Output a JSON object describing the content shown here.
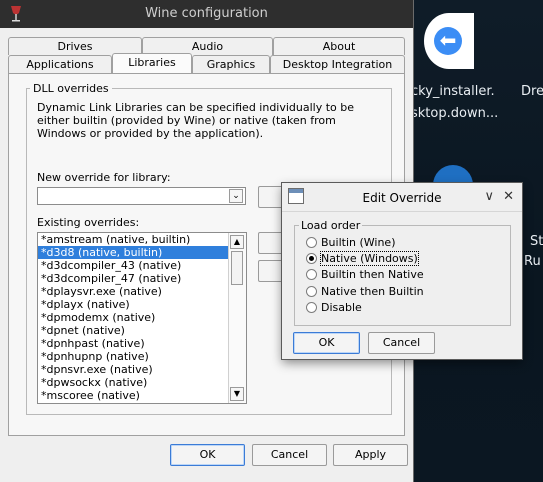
{
  "desktop": {
    "icon_labels": [
      "cky_installer.",
      "Dre",
      "sktop.down...",
      "St",
      "Ru"
    ]
  },
  "window": {
    "title": "Wine configuration",
    "tabs_back": [
      "Drives",
      "Audio",
      "About"
    ],
    "tabs_front": [
      "Applications",
      "Libraries",
      "Graphics",
      "Desktop Integration"
    ],
    "active_tab": "Libraries"
  },
  "dll": {
    "group_title": "DLL overrides",
    "description": "Dynamic Link Libraries can be specified individually to be either builtin (provided by Wine) or native (taken from Windows or provided by the application).",
    "new_override_label": "New override for library:",
    "new_override_value": "",
    "existing_label": "Existing overrides:",
    "existing": [
      "*amstream (native, builtin)",
      "*d3d8 (native, builtin)",
      "*d3dcompiler_43 (native)",
      "*d3dcompiler_47 (native)",
      "*dplaysvr.exe (native)",
      "*dplayx (native)",
      "*dpmodemx (native)",
      "*dpnet (native)",
      "*dpnhpast (native)",
      "*dpnhupnp (native)",
      "*dpnsvr.exe (native)",
      "*dpwsockx (native)",
      "*mscoree (native)"
    ],
    "selected_index": 1
  },
  "footer": {
    "ok": "OK",
    "cancel": "Cancel",
    "apply": "Apply"
  },
  "edit_override": {
    "title": "Edit Override",
    "group_title": "Load order",
    "options": [
      "Builtin (Wine)",
      "Native (Windows)",
      "Builtin then Native",
      "Native then Builtin",
      "Disable"
    ],
    "selected_index": 1,
    "ok": "OK",
    "cancel": "Cancel",
    "minimize_glyph": "∨",
    "close_glyph": "✕"
  },
  "colors": {
    "selection": "#2f7fdc",
    "default_button_border": "#3b7bd6",
    "desktop_icon_blue": "#3b8df5"
  }
}
